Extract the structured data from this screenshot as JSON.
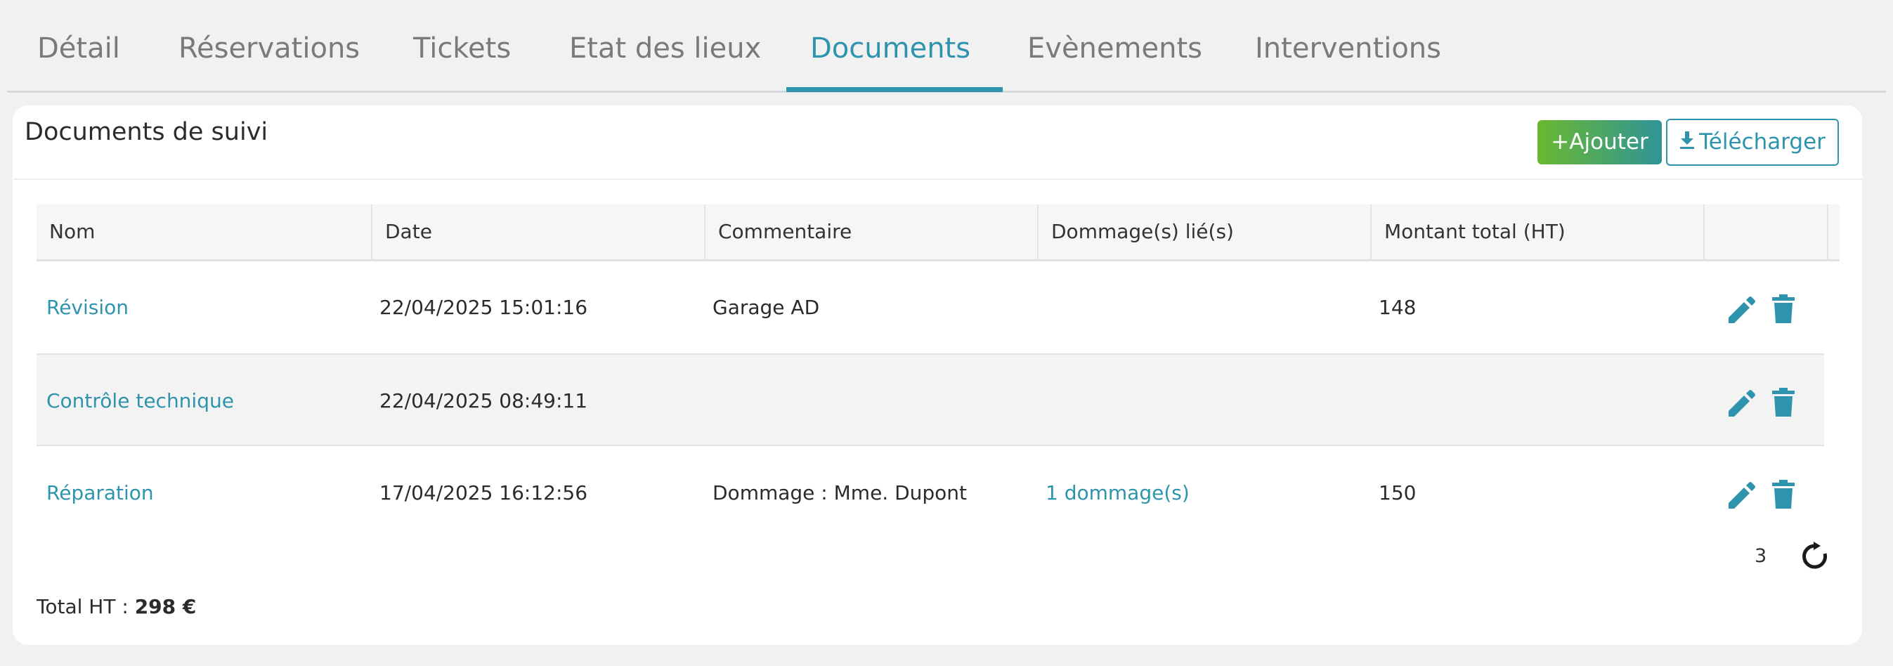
{
  "tabs": [
    {
      "label": "Détail",
      "active": false
    },
    {
      "label": "Réservations",
      "active": false
    },
    {
      "label": "Tickets",
      "active": false
    },
    {
      "label": "Etat des lieux",
      "active": false
    },
    {
      "label": "Documents",
      "active": true
    },
    {
      "label": "Evènements",
      "active": false
    },
    {
      "label": "Interventions",
      "active": false
    }
  ],
  "card": {
    "title": "Documents de suivi",
    "add_button": "Ajouter",
    "add_icon": "+",
    "download_button": "Télécharger"
  },
  "table": {
    "columns": [
      "Nom",
      "Date",
      "Commentaire",
      "Dommage(s) lié(s)",
      "Montant total (HT)",
      ""
    ],
    "rows": [
      {
        "nom": "Révision",
        "date": "22/04/2025 15:01:16",
        "commentaire": "Garage AD",
        "dommages": "",
        "montant": "148"
      },
      {
        "nom": "Contrôle technique",
        "date": "22/04/2025 08:49:11",
        "commentaire": "",
        "dommages": "",
        "montant": ""
      },
      {
        "nom": "Réparation",
        "date": "17/04/2025 16:12:56",
        "commentaire": "Dommage : Mme. Dupont",
        "dommages": "1 dommage(s)",
        "montant": "150"
      }
    ],
    "count": "3"
  },
  "total": {
    "label": "Total HT :",
    "value": "298 €"
  },
  "colors": {
    "accent": "#2e94ad",
    "add_gradient_start": "#6ab82f",
    "add_gradient_end": "#2f9498"
  },
  "icons": {
    "edit": "pencil-icon",
    "delete": "trash-icon",
    "download": "download-icon",
    "refresh": "refresh-icon"
  }
}
